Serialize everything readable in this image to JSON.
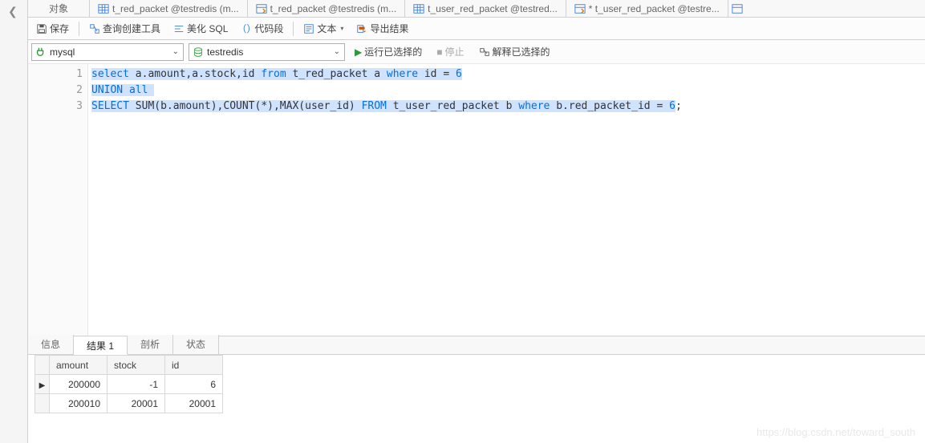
{
  "tabs": {
    "object": "对象",
    "items": [
      {
        "icon": "datasheet",
        "label": "t_red_packet @testredis (m..."
      },
      {
        "icon": "query-b",
        "label": "t_red_packet @testredis (m..."
      },
      {
        "icon": "datasheet",
        "label": "t_user_red_packet @testred..."
      },
      {
        "icon": "query-b",
        "label": "* t_user_red_packet @testre..."
      }
    ]
  },
  "toolbar": {
    "save": "保存",
    "query_builder": "查询创建工具",
    "beautify": "美化 SQL",
    "snippet": "代码段",
    "text": "文本",
    "export": "导出结果"
  },
  "dropdowns": {
    "db": "mysql",
    "schema": "testredis",
    "run": "运行已选择的",
    "stop": "停止",
    "explain": "解释已选择的"
  },
  "editor": {
    "line_numbers": [
      "1",
      "2",
      "3"
    ],
    "parts": {
      "l1_p1": "select",
      "l1_p2": " a.amount,a.stock,id ",
      "l1_p3": "from",
      "l1_p4": " t_red_packet a ",
      "l1_p5": "where",
      "l1_p6": " id = ",
      "l1_p7": "6",
      "l2_p1": "UNION all",
      "l3_p1": "SELECT",
      "l3_p2": " SUM(b.amount),COUNT(*),MAX(user_id) ",
      "l3_p3": "FROM",
      "l3_p4": " t_user_red_packet b ",
      "l3_p5": "where",
      "l3_p6": " b.red_packet_id = ",
      "l3_p7": "6",
      "l3_p8": ";"
    }
  },
  "result_tabs": {
    "info": "信息",
    "result1": "结果 1",
    "profile": "剖析",
    "status": "状态"
  },
  "grid": {
    "headers": [
      "amount",
      "stock",
      "id"
    ],
    "rows": [
      [
        "200000",
        "-1",
        "6"
      ],
      [
        "200010",
        "20001",
        "20001"
      ]
    ]
  },
  "watermark": "https://blog.csdn.net/toward_south"
}
